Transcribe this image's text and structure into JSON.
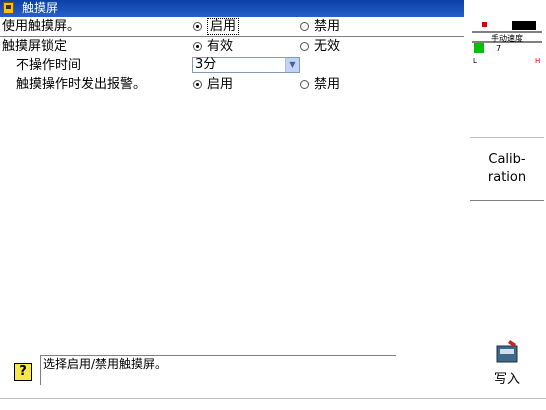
{
  "title": "触摸屏",
  "rows": [
    {
      "label": "使用触摸屏。",
      "opt1": "启用",
      "opt2": "禁用"
    },
    {
      "label": "触摸屏锁定",
      "opt1": "有效",
      "opt2": "无效"
    },
    {
      "label": "不操作时间",
      "select": "3分"
    },
    {
      "label": "触摸操作时发出报警。",
      "opt1": "启用",
      "opt2": "禁用"
    }
  ],
  "help_text": "选择启用/禁用触摸屏。",
  "right_panel": {
    "speed_label": "手动速度",
    "speed_value": "7",
    "l_label": "L",
    "h_label": "H",
    "calibration_line1": "Calib-",
    "calibration_line2": "ration",
    "write_label": "写入"
  },
  "colors": {
    "titlebar": "#0a40a8",
    "help_icon": "#f6e84a"
  }
}
